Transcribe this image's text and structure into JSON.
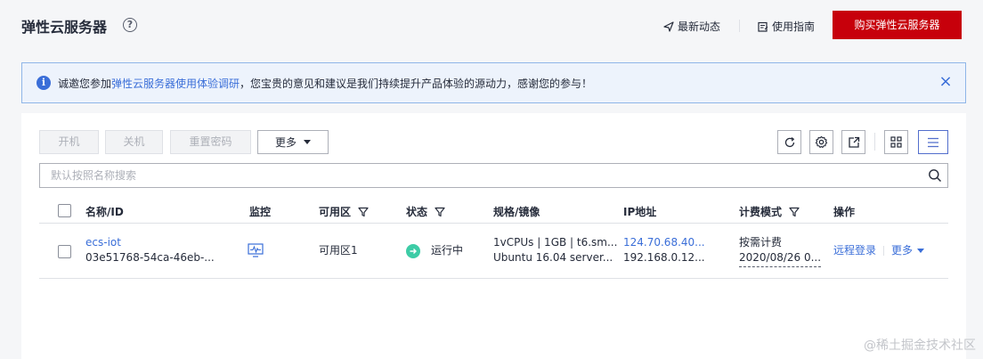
{
  "header": {
    "title": "弹性云服务器",
    "help_icon": "?",
    "news_label": "最新动态",
    "guide_label": "使用指南",
    "buy_label": "购买弹性云服务器"
  },
  "notice": {
    "prefix": "诚邀您参加",
    "link": "弹性云服务器使用体验调研",
    "suffix": "，您宝贵的意见和建议是我们持续提升产品体验的源动力，感谢您的参与！",
    "info_icon": "i",
    "close_icon": "×"
  },
  "toolbar": {
    "start_label": "开机",
    "stop_label": "关机",
    "reset_pwd_label": "重置密码",
    "more_label": "更多",
    "icons": [
      "refresh-icon",
      "settings-icon",
      "export-icon",
      "grid-view-icon",
      "list-view-icon"
    ]
  },
  "search": {
    "placeholder": "默认按照名称搜索"
  },
  "table": {
    "headers": {
      "name": "名称/ID",
      "monitor": "监控",
      "az": "可用区",
      "status": "状态",
      "spec": "规格/镜像",
      "ip": "IP地址",
      "billing": "计费模式",
      "ops": "操作"
    },
    "rows": [
      {
        "name": "ecs-iot",
        "id": "03e51768-54ca-46eb-...",
        "az": "可用区1",
        "status": "运行中",
        "spec": "1vCPUs | 1GB | t6.sm...",
        "image": "Ubuntu 16.04 server...",
        "public_ip": "124.70.68.40...",
        "private_ip": "192.168.0.12...",
        "billing": "按需计费",
        "created": "2020/08/26 0...",
        "op_remote": "远程登录",
        "op_more": "更多"
      }
    ]
  },
  "watermark": "@稀土掘金技术社区",
  "colors": {
    "brand_red": "#c7000b",
    "link_blue": "#3a6ed8",
    "running_green": "#3dcca6"
  }
}
